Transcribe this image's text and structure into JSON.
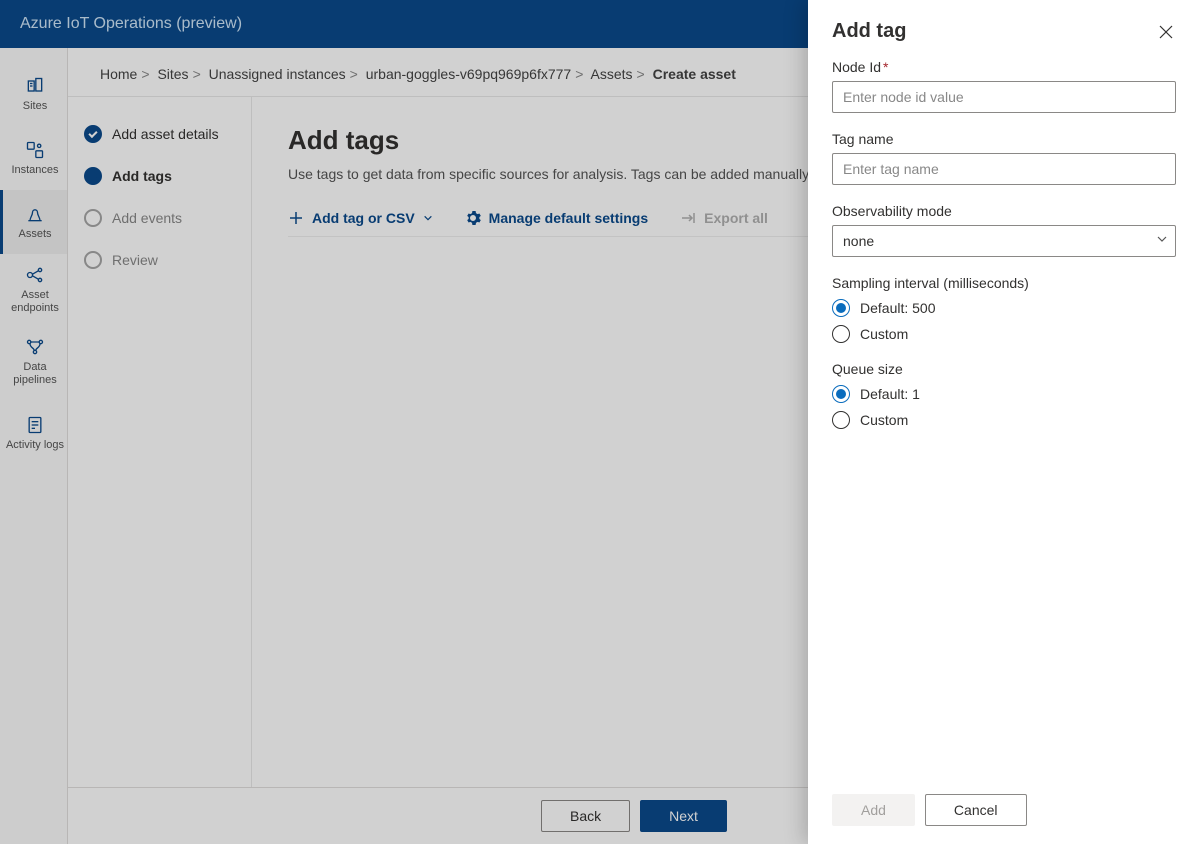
{
  "header": {
    "title": "Azure IoT Operations (preview)"
  },
  "leftnav": [
    {
      "key": "sites",
      "label": "Sites"
    },
    {
      "key": "instances",
      "label": "Instances"
    },
    {
      "key": "assets",
      "label": "Assets",
      "active": true
    },
    {
      "key": "asset-endpoints",
      "label": "Asset endpoints"
    },
    {
      "key": "data-pipelines",
      "label": "Data pipelines"
    },
    {
      "key": "activity-logs",
      "label": "Activity logs"
    }
  ],
  "breadcrumb": {
    "items": [
      "Home",
      "Sites",
      "Unassigned instances",
      "urban-goggles-v69pq969p6fx777",
      "Assets"
    ],
    "current": "Create asset"
  },
  "steps": [
    {
      "label": "Add asset details",
      "state": "done"
    },
    {
      "label": "Add tags",
      "state": "current"
    },
    {
      "label": "Add events",
      "state": "pending"
    },
    {
      "label": "Review",
      "state": "pending"
    }
  ],
  "main": {
    "title": "Add tags",
    "description": "Use tags to get data from specific sources for analysis. Tags can be added manually, imported from a file, or added through OPC UA.",
    "cmd_add": "Add tag or CSV",
    "cmd_manage": "Manage default settings",
    "cmd_export": "Export all"
  },
  "footer": {
    "back": "Back",
    "next": "Next"
  },
  "flyout": {
    "title": "Add tag",
    "node_id_label": "Node Id",
    "node_id_placeholder": "Enter node id value",
    "tag_name_label": "Tag name",
    "tag_name_placeholder": "Enter tag name",
    "obs_label": "Observability mode",
    "obs_value": "none",
    "sampling_label": "Sampling interval (milliseconds)",
    "sampling_default": "Default: 500",
    "sampling_custom": "Custom",
    "queue_label": "Queue size",
    "queue_default": "Default: 1",
    "queue_custom": "Custom",
    "add_btn": "Add",
    "cancel_btn": "Cancel"
  }
}
